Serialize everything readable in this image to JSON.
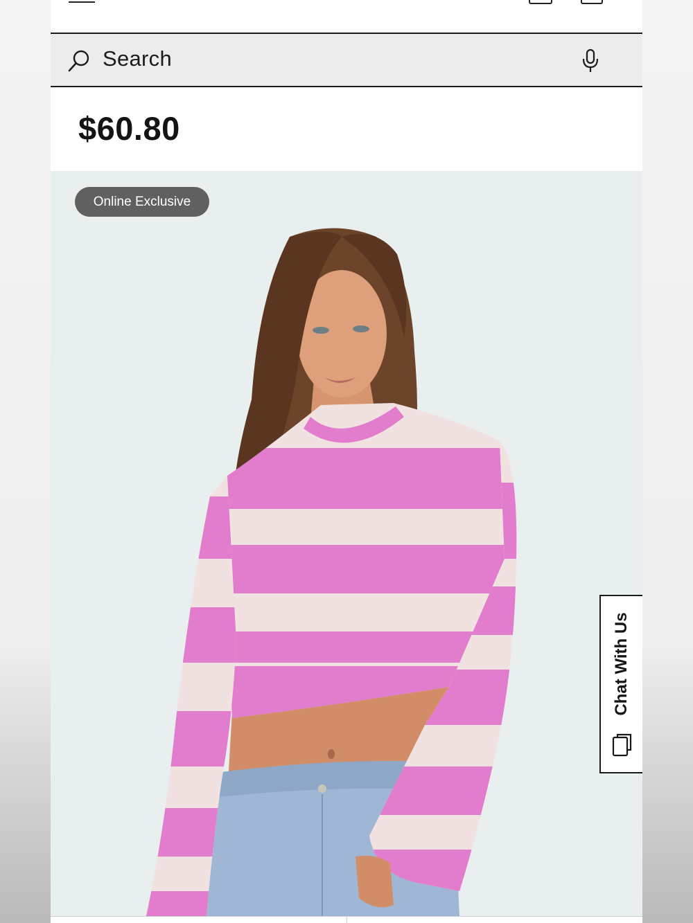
{
  "search": {
    "label": "Search",
    "icon": "search-icon",
    "mic_icon": "microphone-icon"
  },
  "header": {
    "menu_icon": "hamburger-menu-icon",
    "account_icon": "account-icon",
    "bag_icon": "shopping-bag-icon"
  },
  "product": {
    "price": "$60.80",
    "badge": "Online Exclusive",
    "image_alt": "striped-sweater-product-image"
  },
  "chat": {
    "label": "Chat With Us",
    "icon": "chat-icon"
  },
  "colors": {
    "sweater_pink": "#e27ccd",
    "sweater_cream": "#f2e1e1",
    "badge_bg": "#5f605f",
    "image_bg": "#e9eeee"
  }
}
